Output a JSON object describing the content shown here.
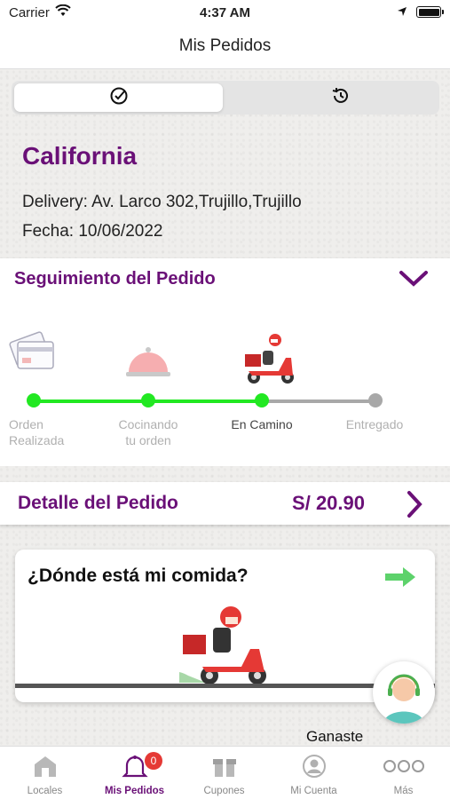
{
  "status_bar": {
    "carrier": "Carrier",
    "time": "4:37 AM"
  },
  "nav": {
    "title": "Mis Pedidos"
  },
  "segmented": {
    "active_icon": "check-circle-icon",
    "history_icon": "history-icon"
  },
  "order": {
    "restaurant": "California",
    "delivery": "Delivery: Av. Larco 302,Trujillo,Trujillo",
    "date": "Fecha: 10/06/2022"
  },
  "tracking": {
    "title": "Seguimiento del Pedido",
    "steps": [
      {
        "label_line1": "Orden",
        "label_line2": "Realizada",
        "icon": "credit-card-icon",
        "done": true
      },
      {
        "label_line1": "Cocinando",
        "label_line2": "tu orden",
        "icon": "food-cloche-icon",
        "done": true
      },
      {
        "label_line1": "En Camino",
        "label_line2": "",
        "icon": "delivery-scooter-icon",
        "done": true,
        "current": true
      },
      {
        "label_line1": "Entregado",
        "label_line2": "",
        "icon": "",
        "done": false
      }
    ],
    "colors": {
      "done": "#22e822",
      "pending": "#a8a8a8"
    }
  },
  "detail": {
    "label": "Detalle del Pedido",
    "amount": "S/ 20.90"
  },
  "where": {
    "question": "¿Dónde está mi comida?"
  },
  "promo": {
    "text": "Ganaste"
  },
  "tabs": [
    {
      "label": "Locales",
      "icon": "store-icon"
    },
    {
      "label": "Mis Pedidos",
      "icon": "bell-icon",
      "badge": "0",
      "active": true
    },
    {
      "label": "Cupones",
      "icon": "gift-icon"
    },
    {
      "label": "Mi Cuenta",
      "icon": "user-icon"
    },
    {
      "label": "Más",
      "icon": "more-icon"
    }
  ],
  "brand_color": "#6a1077"
}
